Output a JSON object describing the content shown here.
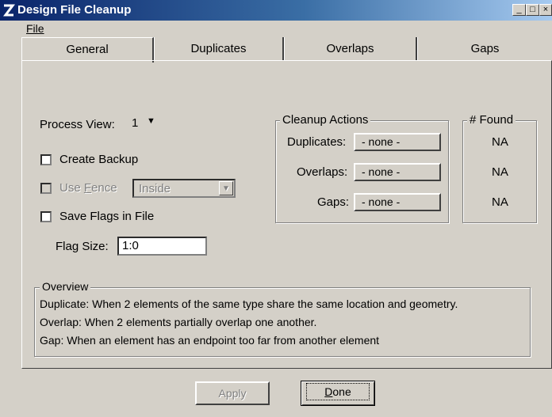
{
  "window": {
    "title": "Design File Cleanup"
  },
  "menu": {
    "file": "File"
  },
  "tabs": [
    "General",
    "Duplicates",
    "Overlaps",
    "Gaps"
  ],
  "general": {
    "process_view_label": "Process View:",
    "process_view_value": "1",
    "create_backup_label": "Create Backup",
    "use_fence_label_pre": "Use ",
    "use_fence_label_key": "F",
    "use_fence_label_post": "ence",
    "fence_mode_value": "Inside",
    "save_flags_label": "Save Flags in File",
    "flag_size_label": "Flag Size:",
    "flag_size_value": "1:0"
  },
  "cleanup_actions": {
    "group_label": "Cleanup Actions",
    "duplicates_label": "Duplicates:",
    "duplicates_value": "- none -",
    "overlaps_label": "Overlaps:",
    "overlaps_value": "- none -",
    "gaps_label": "Gaps:",
    "gaps_value": "- none -"
  },
  "found": {
    "group_label": "# Found",
    "duplicates": "NA",
    "overlaps": "NA",
    "gaps": "NA"
  },
  "overview": {
    "group_label": "Overview",
    "line1": "Duplicate: When 2 elements of the same type share the same location and geometry.",
    "line2": "Overlap: When 2 elements partially overlap one another.",
    "line3": "Gap: When an element has an endpoint too far from another element"
  },
  "buttons": {
    "apply": "Apply",
    "done_key": "D",
    "done_rest": "one"
  }
}
